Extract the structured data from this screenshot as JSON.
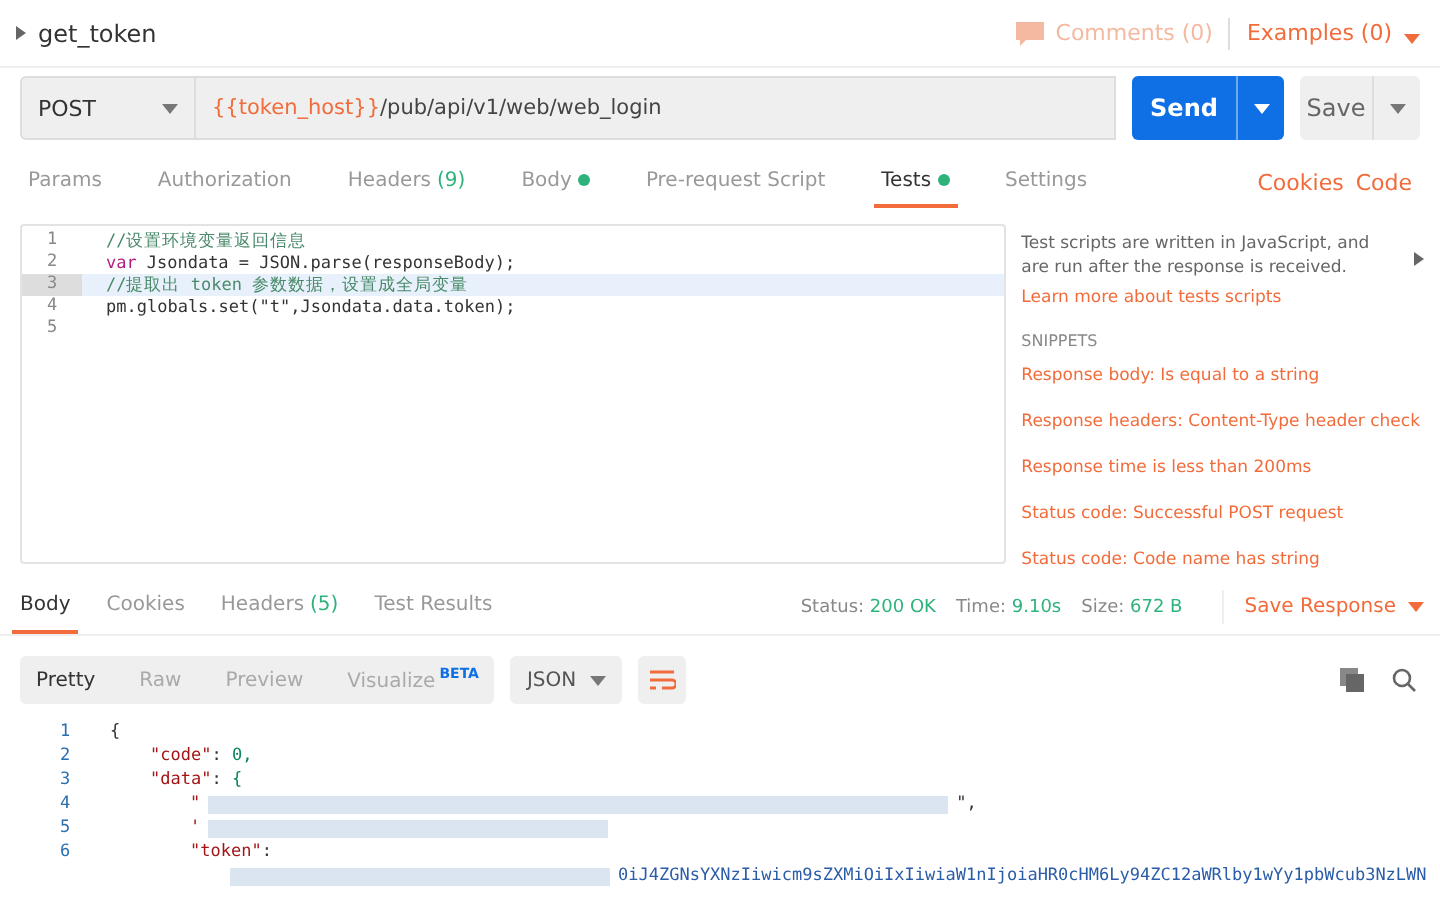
{
  "request": {
    "name": "get_token",
    "comments": "Comments (0)",
    "examples": "Examples (0)"
  },
  "url_bar": {
    "method": "POST",
    "url_variable": "{{token_host}}",
    "url_path": "/pub/api/v1/web/web_login",
    "send": "Send",
    "save": "Save"
  },
  "request_tabs": [
    {
      "label": "Params",
      "dot": false,
      "selected": false
    },
    {
      "label": "Authorization",
      "dot": false,
      "selected": false
    },
    {
      "label": "Headers",
      "count": "(9)",
      "dot": false,
      "selected": false
    },
    {
      "label": "Body",
      "dot": true,
      "selected": false
    },
    {
      "label": "Pre-request Script",
      "dot": false,
      "selected": false
    },
    {
      "label": "Tests",
      "dot": true,
      "selected": true
    },
    {
      "label": "Settings",
      "dot": false,
      "selected": false
    }
  ],
  "request_links": [
    "Cookies",
    "Code"
  ],
  "editor": {
    "lines": [
      {
        "number": "1",
        "kind": "comment",
        "text": "//设置环境变量返回信息",
        "active": false
      },
      {
        "number": "2",
        "kind": "declaration",
        "keyword": "var",
        "text": "Jsondata = JSON.parse(responseBody);",
        "active": false
      },
      {
        "number": "3",
        "kind": "comment",
        "text": "//提取出 token 参数数据，设置成全局变量",
        "active": true
      },
      {
        "number": "4",
        "kind": "call",
        "text": "pm.globals.set(\"t\",Jsondata.data.token);",
        "active": false
      },
      {
        "number": "5",
        "kind": "blank",
        "active": false
      }
    ]
  },
  "help": {
    "description": "Test scripts are written in JavaScript, and are run after the response is received.",
    "link": "Learn more about tests scripts",
    "snippets_title": "SNIPPETS",
    "snippets": [
      "Response body: Is equal to a string",
      "Response headers: Content-Type header check",
      "Response time is less than 200ms",
      "Status code: Successful POST request",
      "Status code: Code name has string"
    ]
  },
  "response_tabs": [
    {
      "label": "Body",
      "selected": true
    },
    {
      "label": "Cookies",
      "selected": false
    },
    {
      "label": "Headers",
      "count": "(5)",
      "selected": false
    },
    {
      "label": "Test Results",
      "selected": false
    }
  ],
  "status": [
    {
      "label": "Status:",
      "value": "200 OK"
    },
    {
      "label": "Time:",
      "value": "9.10s"
    },
    {
      "label": "Size:",
      "value": "672 B"
    }
  ],
  "save_response": "Save Response",
  "view_modes": [
    {
      "label": "Pretty",
      "selected": true
    },
    {
      "label": "Raw",
      "selected": false
    },
    {
      "label": "Preview",
      "selected": false
    },
    {
      "label": "Visualize",
      "badge": "BETA",
      "selected": false
    }
  ],
  "format": "JSON",
  "response_lines": [
    {
      "number": "1",
      "kind": "brace",
      "text": "{"
    },
    {
      "number": "2",
      "kind": "pair",
      "key": "\"code\"",
      "separator": ":",
      "value": "0,"
    },
    {
      "number": "3",
      "kind": "pair",
      "key": "\"data\"",
      "separator": ":",
      "value": "{"
    },
    {
      "number": "4",
      "kind": "redacted",
      "text": "\"",
      "tail": "\","
    },
    {
      "number": "5",
      "kind": "redacted",
      "text": "'"
    },
    {
      "number": "6",
      "kind": "key",
      "key": "\"token\"",
      "separator": ":"
    },
    {
      "kind": "token",
      "text": "0iJ4ZGNsYXNzIiwicm9sZXMiOiIxIiwiaW1nIjoiaHR0cHM6Ly94ZC12aWRlby1wYy1pbWcub3NzLWN"
    }
  ]
}
